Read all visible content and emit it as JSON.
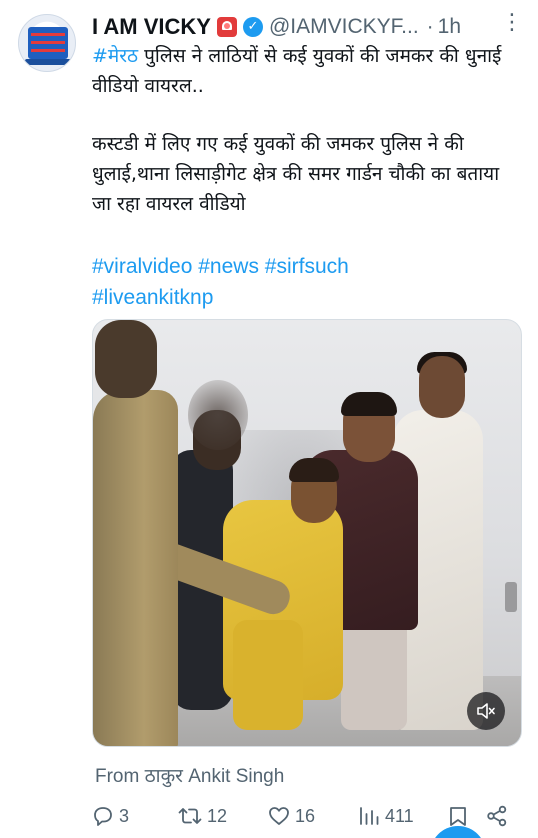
{
  "tweet": {
    "author_name": "I AM VICKY",
    "handle": "@IAMVICKYF...",
    "separator": "·",
    "time": "1h",
    "text_line1_hashtag": "#मेरठ",
    "text_line1": " पुलिस ने लाठियों से कई युवकों की जमकर की धुनाई वीडियो वायरल..",
    "text_paragraph2": "कस्टडी में लिए गए कई युवकों की जमकर पुलिस ने की धुलाई,थाना लिसाड़ीगेट क्षेत्र की समर गार्डन चौकी का बताया जा रहा वायरल वीडियो",
    "hashtags": [
      "#viralvideo",
      "#news",
      "#sirfsuch",
      "#liveankitknp"
    ],
    "attribution": "From ठाकुर Ankit Singh"
  },
  "actions": {
    "replies": "3",
    "retweets": "12",
    "likes": "16",
    "views": "411"
  },
  "icons": {
    "avatar": "avatar",
    "siren": "siren-emoji-icon",
    "verified": "verified-badge-icon",
    "more": "more-options-icon",
    "mute": "mute-icon",
    "reply": "reply-icon",
    "retweet": "retweet-icon",
    "like": "heart-icon",
    "views": "views-icon",
    "bookmark": "bookmark-icon",
    "share": "share-icon"
  },
  "colors": {
    "text": "#0f1419",
    "secondary": "#536471",
    "link": "#1d9bf0"
  }
}
